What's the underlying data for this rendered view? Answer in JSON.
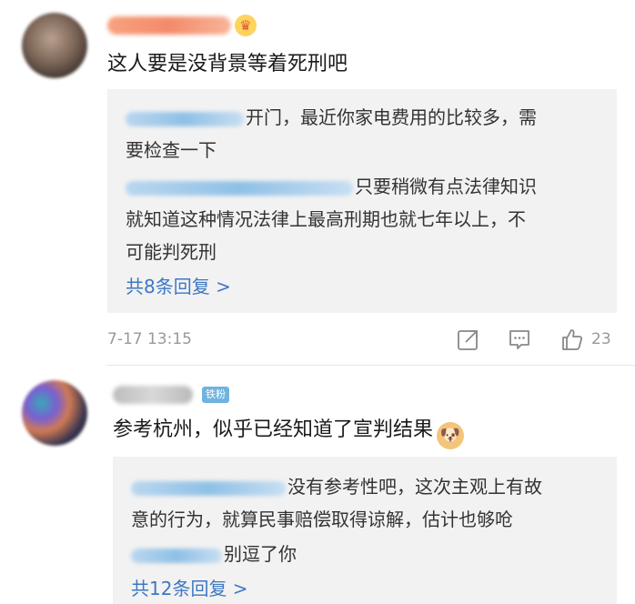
{
  "comment1": {
    "text": "这人要是没背景等着死刑吧",
    "replies": [
      {
        "text": "开门，最近你家电费用的比较多，需"
      },
      {
        "text": "要检查一下"
      },
      {
        "text": "只要稍微有点法律知识"
      },
      {
        "text": "就知道这种情况法律上最高刑期也就七年以上，不"
      },
      {
        "text": "可能判死刑"
      }
    ],
    "more_label": "共8条回复 >",
    "time": "7-17 13:15",
    "likes": "23"
  },
  "comment2": {
    "badge": "铁粉",
    "text": "参考杭州，似乎已经知道了宣判结果",
    "replies": [
      {
        "text": "没有参考性吧，这次主观上有故"
      },
      {
        "text": "意的行为，就算民事赔偿取得谅解，估计也够呛"
      },
      {
        "text": "别逗了你"
      }
    ],
    "more_label": "共12条回复 >"
  },
  "icons": {
    "share": "share-icon",
    "comment": "comment-icon",
    "like": "thumbs-up-icon",
    "user_badge": "crown-icon",
    "emoji": "doge-emoji"
  },
  "colors": {
    "link": "#3d78c2",
    "reply_bg": "#f2f2f2",
    "muted": "#999999"
  }
}
